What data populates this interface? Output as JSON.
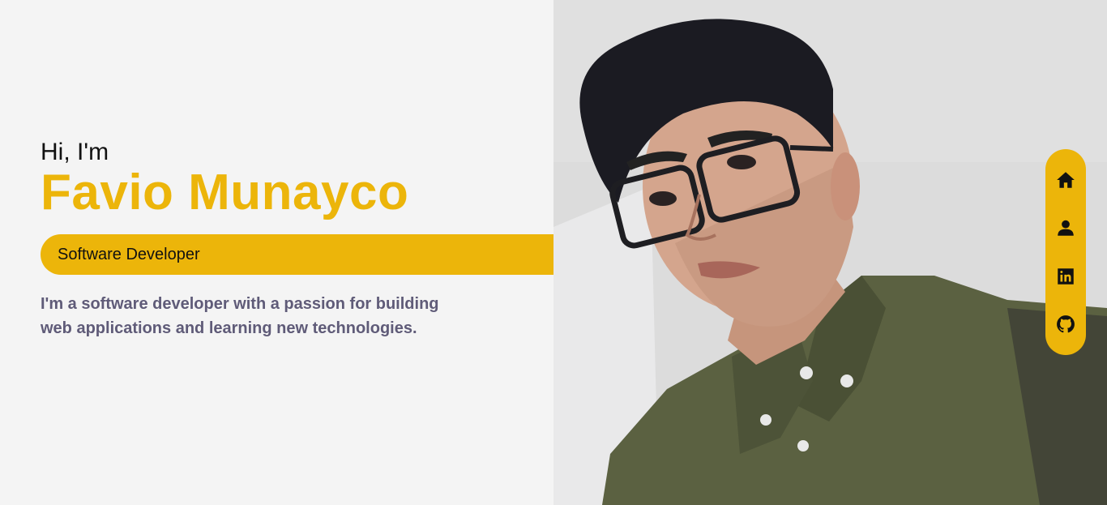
{
  "hero": {
    "greeting": "Hi, I'm",
    "name": "Favio Munayco",
    "role": "Software Developer",
    "bio": "I'm a software developer with a passion for building web applications and learning new technologies."
  },
  "nav": {
    "items": [
      {
        "icon": "home-icon",
        "label": "Home"
      },
      {
        "icon": "user-icon",
        "label": "About"
      },
      {
        "icon": "linkedin-icon",
        "label": "LinkedIn"
      },
      {
        "icon": "github-icon",
        "label": "GitHub"
      }
    ]
  },
  "colors": {
    "accent": "#ecb50a",
    "background": "#f4f4f4",
    "bio_text": "#5f5b78",
    "shirt": "#5b6141"
  }
}
